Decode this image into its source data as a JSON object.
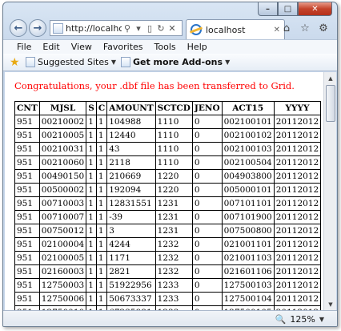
{
  "browser": {
    "address": "http://localhost",
    "tab_title": "localhost",
    "zoom": "125%"
  },
  "menu": [
    "File",
    "Edit",
    "View",
    "Favorites",
    "Tools",
    "Help"
  ],
  "favorites": {
    "suggested_sites": "Suggested Sites",
    "get_addons": "Get more Add-ons"
  },
  "page": {
    "message": "Congratulations, your .dbf file has been transferred to Grid."
  },
  "table": {
    "headers": [
      "CNT",
      "MJSL",
      "S",
      "C",
      "AMOUNT",
      "SCTCD",
      "JENO",
      "ACT15",
      "YYYY"
    ],
    "rows": [
      [
        "951",
        "00210002",
        "1",
        "1",
        "104988",
        "1110",
        "0",
        "002100101",
        "20112012"
      ],
      [
        "951",
        "00210005",
        "1",
        "1",
        "12440",
        "1110",
        "0",
        "002100102",
        "20112012"
      ],
      [
        "951",
        "00210031",
        "1",
        "1",
        "43",
        "1110",
        "0",
        "002100103",
        "20112012"
      ],
      [
        "951",
        "00210060",
        "1",
        "1",
        "2118",
        "1110",
        "0",
        "002100504",
        "20112012"
      ],
      [
        "951",
        "00490150",
        "1",
        "1",
        "210669",
        "1220",
        "0",
        "004903800",
        "20112012"
      ],
      [
        "951",
        "00500002",
        "1",
        "1",
        "192094",
        "1220",
        "0",
        "005000101",
        "20112012"
      ],
      [
        "951",
        "00710003",
        "1",
        "1",
        "12831551",
        "1231",
        "0",
        "007101101",
        "20112012"
      ],
      [
        "951",
        "00710007",
        "1",
        "1",
        "-39",
        "1231",
        "0",
        "007101900",
        "20112012"
      ],
      [
        "951",
        "00750012",
        "1",
        "1",
        "3",
        "1231",
        "0",
        "007500800",
        "20112012"
      ],
      [
        "951",
        "02100004",
        "1",
        "1",
        "4244",
        "1232",
        "0",
        "021001101",
        "20112012"
      ],
      [
        "951",
        "02100005",
        "1",
        "1",
        "1171",
        "1232",
        "0",
        "021001103",
        "20112012"
      ],
      [
        "951",
        "02160003",
        "1",
        "1",
        "2821",
        "1232",
        "0",
        "021601106",
        "20112012"
      ],
      [
        "951",
        "12750003",
        "1",
        "1",
        "51922956",
        "1233",
        "0",
        "127500103",
        "20112012"
      ],
      [
        "951",
        "12750006",
        "1",
        "1",
        "50673337",
        "1233",
        "0",
        "127500104",
        "20112012"
      ],
      [
        "951",
        "12750010",
        "1",
        "1",
        "67235981",
        "1233",
        "0",
        "127500105",
        "20112012"
      ]
    ]
  }
}
